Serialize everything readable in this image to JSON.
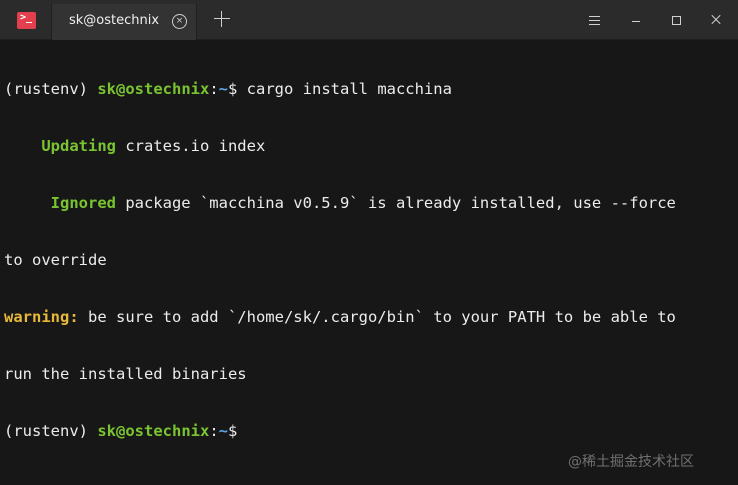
{
  "window": {
    "tab_title": "sk@ostechnix",
    "tab_close_glyph": "×",
    "icon_glyph": ">"
  },
  "terminal": {
    "lines": [
      {
        "env": "(rustenv) ",
        "user": "sk@ostechnix",
        "colon": ":",
        "path": "~",
        "dollar": "$ ",
        "command": "cargo install macchina"
      },
      {
        "label": "    Updating",
        "text": " crates.io index"
      },
      {
        "label": "     Ignored",
        "text": " package `macchina v0.5.9` is already installed, use --force"
      },
      {
        "text": "to override"
      },
      {
        "label": "warning:",
        "text": " be sure to add `/home/sk/.cargo/bin` to your PATH to be able to"
      },
      {
        "text": "run the installed binaries"
      },
      {
        "env": "(rustenv) ",
        "user": "sk@ostechnix",
        "colon": ":",
        "path": "~",
        "dollar": "$"
      }
    ]
  },
  "watermark": "@稀土掘金技术社区",
  "colors": {
    "background": "#171717",
    "titlebar": "#2b2b2b",
    "green": "#7ac431",
    "blue": "#58a6e8",
    "yellow": "#e8b83a",
    "icon_red": "#e2404f"
  }
}
